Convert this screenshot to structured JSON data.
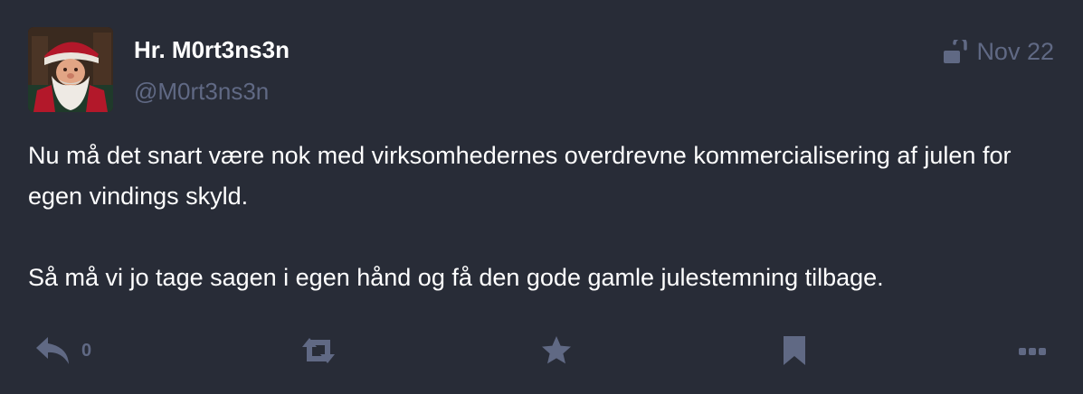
{
  "author": {
    "display_name": "Hr. M0rt3ns3n",
    "handle": "@M0rt3ns3n",
    "avatar_description": "santa-portrait"
  },
  "meta": {
    "visibility_icon": "unlock-icon",
    "date": "Nov 22"
  },
  "content": {
    "paragraphs": [
      "Nu må det snart være nok med virksomhedernes overdrevne kommercialisering af julen for egen vindings skyld.",
      "Så må vi jo tage sagen i egen hånd og få den gode gamle julestemning tilbage."
    ]
  },
  "actions": {
    "reply_icon": "reply-icon",
    "reply_count": "0",
    "boost_icon": "retweet-icon",
    "favourite_icon": "star-icon",
    "bookmark_icon": "bookmark-icon",
    "more_icon": "ellipsis-icon"
  },
  "colors": {
    "background": "#282c37",
    "text": "#ffffff",
    "muted": "#606984"
  }
}
